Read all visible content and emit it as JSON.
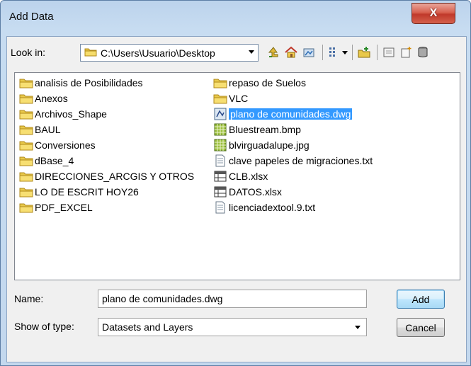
{
  "window": {
    "title": "Add Data",
    "close_glyph": "X"
  },
  "lookin": {
    "label": "Look in:",
    "path": "C:\\Users\\Usuario\\Desktop"
  },
  "toolbar": [
    "up-one-level",
    "go-home",
    "connect-folder",
    "view-options",
    "new-folder",
    "catalog-tree",
    "new-item",
    "connect-database"
  ],
  "files_col1": [
    {
      "name": "analisis de Posibilidades",
      "icon": "folder-icon"
    },
    {
      "name": "Anexos",
      "icon": "folder-icon"
    },
    {
      "name": "Archivos_Shape",
      "icon": "folder-icon"
    },
    {
      "name": "BAUL",
      "icon": "folder-icon"
    },
    {
      "name": "Conversiones",
      "icon": "folder-icon"
    },
    {
      "name": "dBase_4",
      "icon": "folder-icon"
    },
    {
      "name": "DIRECCIONES_ARCGIS Y OTROS",
      "icon": "folder-icon"
    },
    {
      "name": "LO DE ESCRIT HOY26",
      "icon": "folder-icon"
    },
    {
      "name": "PDF_EXCEL",
      "icon": "folder-icon"
    }
  ],
  "files_col2": [
    {
      "name": "repaso de Suelos",
      "icon": "folder-icon"
    },
    {
      "name": "VLC",
      "icon": "folder-icon"
    },
    {
      "name": "plano de comunidades.dwg",
      "icon": "cad-file-icon",
      "selected": true
    },
    {
      "name": "Bluestream.bmp",
      "icon": "raster-icon"
    },
    {
      "name": "blvirguadalupe.jpg",
      "icon": "raster-icon"
    },
    {
      "name": "clave  papeles de migraciones.txt",
      "icon": "text-file-icon"
    },
    {
      "name": "CLB.xlsx",
      "icon": "table-icon"
    },
    {
      "name": "DATOS.xlsx",
      "icon": "table-icon"
    },
    {
      "name": "licenciadextool.9.txt",
      "icon": "text-file-icon"
    }
  ],
  "name_field": {
    "label": "Name:",
    "value": "plano de comunidades.dwg"
  },
  "type_field": {
    "label": "Show of type:",
    "value": "Datasets and Layers"
  },
  "buttons": {
    "add": "Add",
    "cancel": "Cancel"
  }
}
